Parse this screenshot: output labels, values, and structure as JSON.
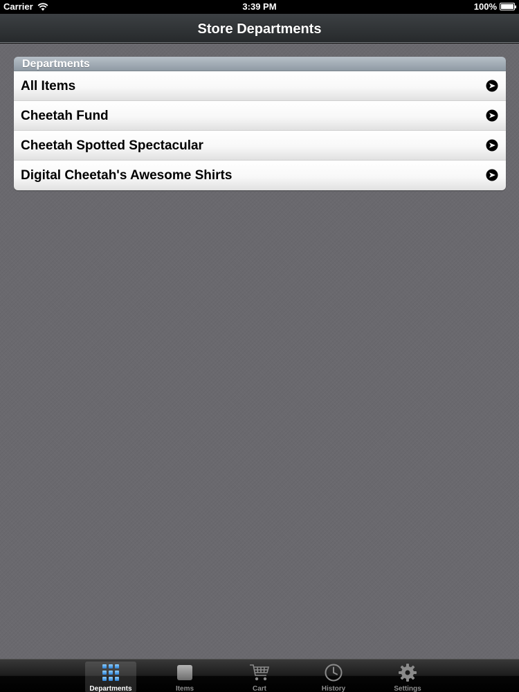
{
  "status_bar": {
    "carrier": "Carrier",
    "time": "3:39 PM",
    "battery": "100%"
  },
  "nav_bar": {
    "title": "Store Departments"
  },
  "table": {
    "section_header": "Departments",
    "rows": [
      {
        "label": "All Items"
      },
      {
        "label": "Cheetah Fund"
      },
      {
        "label": "Cheetah Spotted Spectacular"
      },
      {
        "label": "Digital Cheetah's Awesome Shirts"
      }
    ]
  },
  "tab_bar": {
    "tabs": [
      {
        "label": "Departments",
        "icon": "grid-icon",
        "active": true
      },
      {
        "label": "Items",
        "icon": "square-icon",
        "active": false
      },
      {
        "label": "Cart",
        "icon": "cart-icon",
        "active": false
      },
      {
        "label": "History",
        "icon": "clock-icon",
        "active": false
      },
      {
        "label": "Settings",
        "icon": "gear-icon",
        "active": false
      }
    ]
  },
  "colors": {
    "background": "#6a696e",
    "nav_bar": "#2e3134",
    "section_header": "#a3adb6",
    "active_tab_icon": "#4aa3e8"
  }
}
